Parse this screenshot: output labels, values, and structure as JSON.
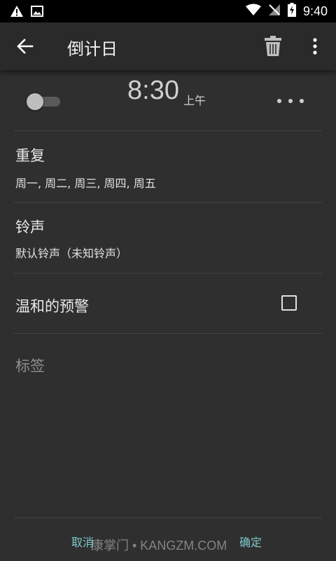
{
  "status_bar": {
    "time": "9:40"
  },
  "app_bar": {
    "title": "倒计日"
  },
  "alarm": {
    "time": "8:30",
    "ampm": "上午"
  },
  "repeat": {
    "title": "重复",
    "value": "周一, 周二, 周三, 周四, 周五"
  },
  "ringtone": {
    "title": "铃声",
    "value": "默认铃声（未知铃声）"
  },
  "gentle_alert": {
    "title": "温和的预警"
  },
  "label": {
    "placeholder": "标签"
  },
  "bottom": {
    "cancel": "取消",
    "ok": "确定",
    "watermark": "康掌门 • KANGZM.COM"
  }
}
